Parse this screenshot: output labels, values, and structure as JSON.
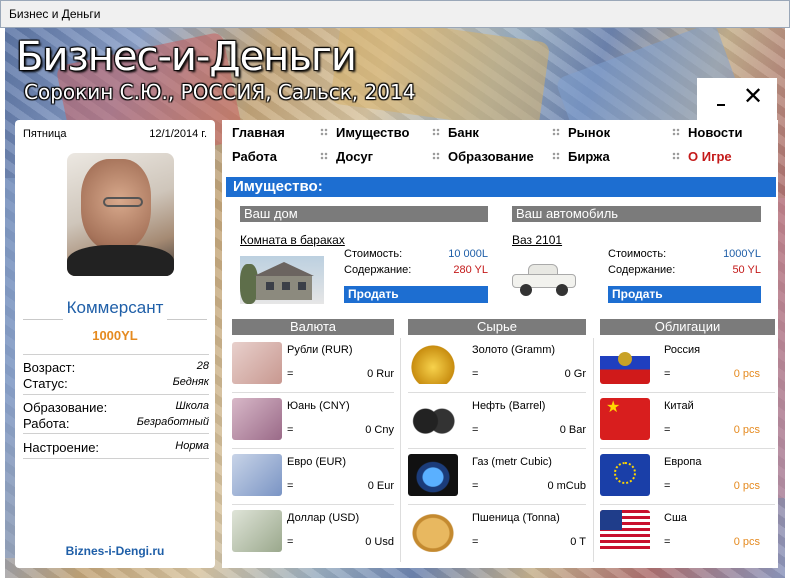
{
  "window": {
    "title": "Бизнес и Деньги"
  },
  "app": {
    "title": "Бизнес-и-Деньги",
    "subtitle": "Сорокин С.Ю., РОССИЯ, Сальск, 2014"
  },
  "controls": {
    "close": "✕"
  },
  "profile": {
    "day": "Пятница",
    "date": "12/1/2014 г.",
    "rank": "Коммерсант",
    "money": "1000YL",
    "stats": [
      {
        "label": "Возраст:",
        "value": "28"
      },
      {
        "label": "Статус:",
        "value": "Бедняк"
      },
      {
        "label": "Образование:",
        "value": "Школа"
      },
      {
        "label": "Работа:",
        "value": "Безработный"
      },
      {
        "label": "Настроение:",
        "value": "Норма"
      }
    ],
    "site": "Biznes-i-Dengi.ru"
  },
  "nav": [
    {
      "label": "Главная"
    },
    {
      "label": "Имущество"
    },
    {
      "label": "Банк"
    },
    {
      "label": "Рынок"
    },
    {
      "label": "Новости"
    },
    {
      "label": "Работа"
    },
    {
      "label": "Досуг"
    },
    {
      "label": "Образование"
    },
    {
      "label": "Биржа"
    },
    {
      "label": "О Игре"
    }
  ],
  "property": {
    "header": "Имущество:",
    "home": {
      "title": "Ваш дом",
      "name": "Комната в бараках",
      "cost_label": "Стоимость:",
      "cost": "10 000L",
      "upkeep_label": "Содержание:",
      "upkeep": "280 YL",
      "sell": "Продать"
    },
    "car": {
      "title": "Ваш автомобиль",
      "name": "Ваз 2101",
      "cost_label": "Стоимость:",
      "cost": "1000YL",
      "upkeep_label": "Содержание:",
      "upkeep": "50 YL",
      "sell": "Продать"
    }
  },
  "currency": {
    "title": "Валюта",
    "rows": [
      {
        "name": "Рубли (RUR)",
        "eq": "=",
        "value": "0 Rur",
        "icon": "ruble-banknote"
      },
      {
        "name": "Юань (CNY)",
        "eq": "=",
        "value": "0 Cny",
        "icon": "yuan-banknote"
      },
      {
        "name": "Евро (EUR)",
        "eq": "=",
        "value": "0 Eur",
        "icon": "euro-banknote"
      },
      {
        "name": "Доллар (USD)",
        "eq": "=",
        "value": "0 Usd",
        "icon": "dollar-banknote"
      }
    ]
  },
  "commodities": {
    "title": "Сырье",
    "rows": [
      {
        "name": "Золото (Gramm)",
        "eq": "=",
        "value": "0 Gr",
        "icon": "gold-bars"
      },
      {
        "name": "Нефть (Barrel)",
        "eq": "=",
        "value": "0 Bar",
        "icon": "oil-barrels"
      },
      {
        "name": "Газ (metr Cubic)",
        "eq": "=",
        "value": "0 mCub",
        "icon": "gas-burner"
      },
      {
        "name": "Пшеница (Tonna)",
        "eq": "=",
        "value": "0 T",
        "icon": "wheat-grain"
      }
    ]
  },
  "bonds": {
    "title": "Облигации",
    "rows": [
      {
        "name": "Россия",
        "eq": "=",
        "value": "0 pcs",
        "icon": "russia-flag"
      },
      {
        "name": "Китай",
        "eq": "=",
        "value": "0 pcs",
        "icon": "china-flag"
      },
      {
        "name": "Европа",
        "eq": "=",
        "value": "0 pcs",
        "icon": "eu-flag"
      },
      {
        "name": "Сша",
        "eq": "=",
        "value": "0 pcs",
        "icon": "usa-flag"
      }
    ]
  },
  "colors": {
    "accent_blue": "#1d6ed1",
    "link_blue": "#1f5fa8",
    "orange": "#e58a1f",
    "red": "#c41a1a",
    "section_gray": "#7b7b7b"
  }
}
